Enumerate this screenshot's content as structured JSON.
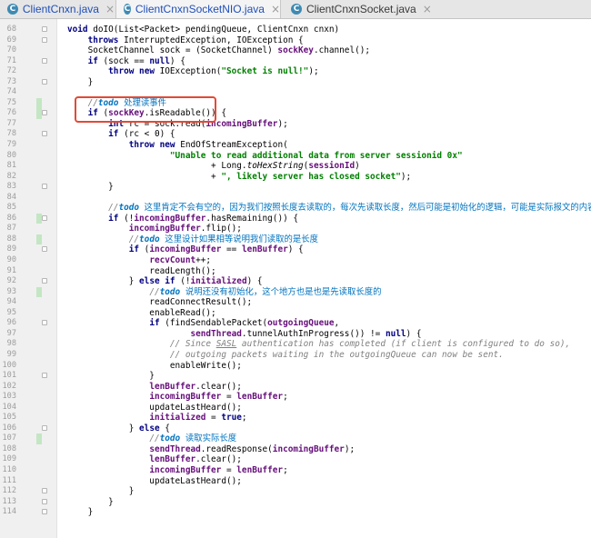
{
  "tabs": [
    {
      "label": "ClientCnxn.java",
      "active": false
    },
    {
      "label": "ClientCnxnSocketNIO.java",
      "active": true
    },
    {
      "label": "ClientCnxnSocket.java",
      "active": false
    }
  ],
  "tab_icon_letter": "C",
  "close_glyph": "×",
  "colors": {
    "keyword": "#000080",
    "field": "#660e7a",
    "string": "#008000",
    "comment": "#808080",
    "todo": "#0073bf",
    "highlight_box": "#e14a36",
    "changed_line": "#c3e6c3"
  },
  "lines": [
    {
      "n": "68",
      "t": "void doIO(List<Packet> pendingQueue, ClientCnxn cnxn)"
    },
    {
      "n": "69",
      "t": "    throws InterruptedException, IOException {"
    },
    {
      "n": "70",
      "t": "    SocketChannel sock = (SocketChannel) sockKey.channel();"
    },
    {
      "n": "71",
      "t": "    if (sock == null) {"
    },
    {
      "n": "72",
      "t": "        throw new IOException(\"Socket is null!\");"
    },
    {
      "n": "73",
      "t": "    }"
    },
    {
      "n": "74",
      "t": ""
    },
    {
      "n": "75",
      "t": "    //todo 处理读事件"
    },
    {
      "n": "76",
      "t": "    if (sockKey.isReadable()) {"
    },
    {
      "n": "77",
      "t": "        int rc = sock.read(incomingBuffer);"
    },
    {
      "n": "78",
      "t": "        if (rc < 0) {"
    },
    {
      "n": "79",
      "t": "            throw new EndOfStreamException("
    },
    {
      "n": "80",
      "t": "                    \"Unable to read additional data from server sessionid 0x\""
    },
    {
      "n": "81",
      "t": "                            + Long.toHexString(sessionId)"
    },
    {
      "n": "82",
      "t": "                            + \", likely server has closed socket\");"
    },
    {
      "n": "83",
      "t": "        }"
    },
    {
      "n": "84",
      "t": ""
    },
    {
      "n": "85",
      "t": "        //todo 这里肯定不会有空的，因为我们按照长度去读取的，每次先读取长度，然后可能是初始化的逻辑，可能是实际报文的内容"
    },
    {
      "n": "86",
      "t": "        if (!incomingBuffer.hasRemaining()) {"
    },
    {
      "n": "87",
      "t": "            incomingBuffer.flip();"
    },
    {
      "n": "88",
      "t": "            //todo 这里设计如果相等说明我们读取的是长度"
    },
    {
      "n": "89",
      "t": "            if (incomingBuffer == lenBuffer) {"
    },
    {
      "n": "90",
      "t": "                recvCount++;"
    },
    {
      "n": "91",
      "t": "                readLength();"
    },
    {
      "n": "92",
      "t": "            } else if (!initialized) {"
    },
    {
      "n": "93",
      "t": "                //todo 说明还没有初始化，这个地方也是也是先读取长度的"
    },
    {
      "n": "94",
      "t": "                readConnectResult();"
    },
    {
      "n": "95",
      "t": "                enableRead();"
    },
    {
      "n": "96",
      "t": "                if (findSendablePacket(outgoingQueue,"
    },
    {
      "n": "97",
      "t": "                        sendThread.tunnelAuthInProgress()) != null) {"
    },
    {
      "n": "98",
      "t": "                    // Since SASL authentication has completed (if client is configured to do so),"
    },
    {
      "n": "99",
      "t": "                    // outgoing packets waiting in the outgoingQueue can now be sent."
    },
    {
      "n": "100",
      "t": "                    enableWrite();"
    },
    {
      "n": "101",
      "t": "                }"
    },
    {
      "n": "102",
      "t": "                lenBuffer.clear();"
    },
    {
      "n": "103",
      "t": "                incomingBuffer = lenBuffer;"
    },
    {
      "n": "104",
      "t": "                updateLastHeard();"
    },
    {
      "n": "105",
      "t": "                initialized = true;"
    },
    {
      "n": "106",
      "t": "            } else {"
    },
    {
      "n": "107",
      "t": "                //todo 读取实际长度"
    },
    {
      "n": "108",
      "t": "                sendThread.readResponse(incomingBuffer);"
    },
    {
      "n": "109",
      "t": "                lenBuffer.clear();"
    },
    {
      "n": "110",
      "t": "                incomingBuffer = lenBuffer;"
    },
    {
      "n": "111",
      "t": "                updateLastHeard();"
    },
    {
      "n": "112",
      "t": "            }"
    },
    {
      "n": "113",
      "t": "        }"
    },
    {
      "n": "114",
      "t": "    }"
    }
  ]
}
